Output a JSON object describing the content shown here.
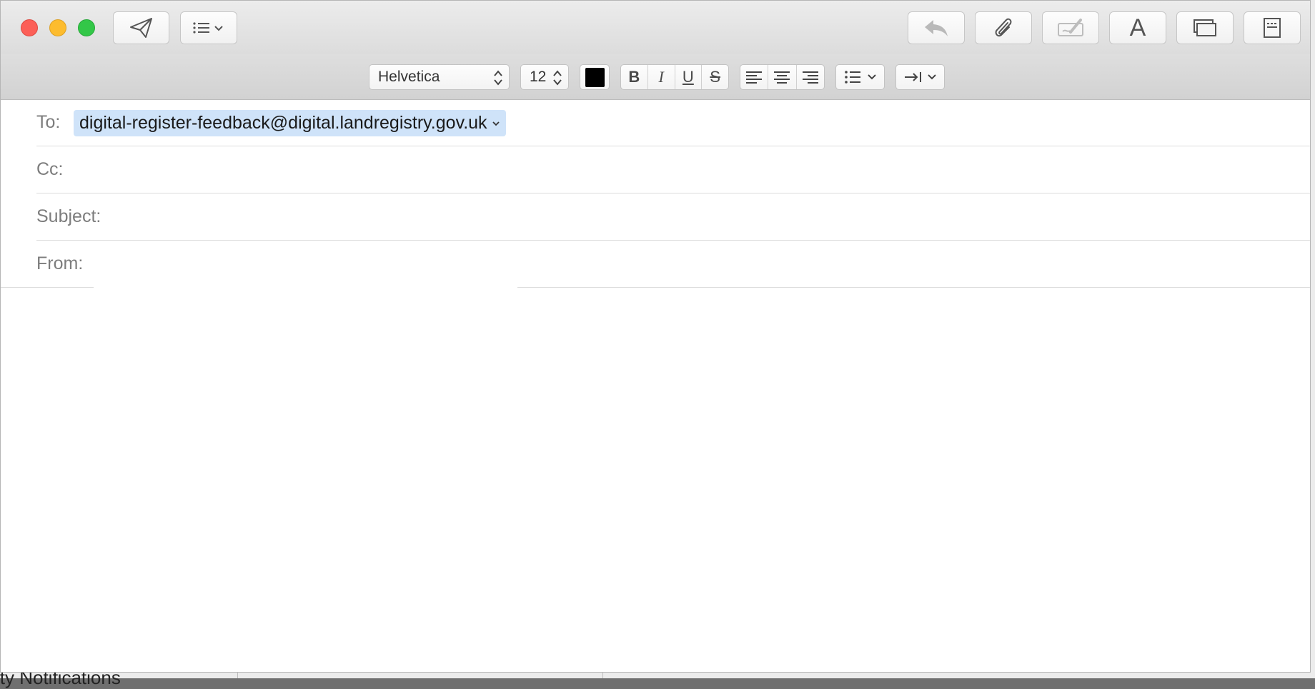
{
  "window": {
    "title_buttons": {
      "close": "close-window",
      "minimize": "minimize-window",
      "zoom": "zoom-window"
    },
    "toolbar": {
      "send_icon": "paper-plane-icon",
      "header_fields_icon": "list-icon",
      "reply_icon": "reply-icon",
      "attach_icon": "paperclip-icon",
      "markup_icon": "markup-icon",
      "fonts_label": "A",
      "browser_icon": "photo-browser-icon",
      "stationery_icon": "stationery-icon"
    },
    "format_bar": {
      "font_family": "Helvetica",
      "font_size": "12",
      "text_color": "#000000",
      "bold": "B",
      "italic": "I",
      "underline": "U",
      "strikethrough": "S"
    },
    "fields": {
      "to_label": "To:",
      "to_recipient": "digital-register-feedback@digital.landregistry.gov.uk",
      "cc_label": "Cc:",
      "subject_label": "Subject:",
      "from_label": "From:"
    }
  },
  "background_window": {
    "partial_text": "ity Notifications"
  },
  "colors": {
    "token_bg": "#cfe3f9",
    "close": "#fc5f57",
    "minimize": "#fdbc2e",
    "zoom": "#33c748"
  }
}
